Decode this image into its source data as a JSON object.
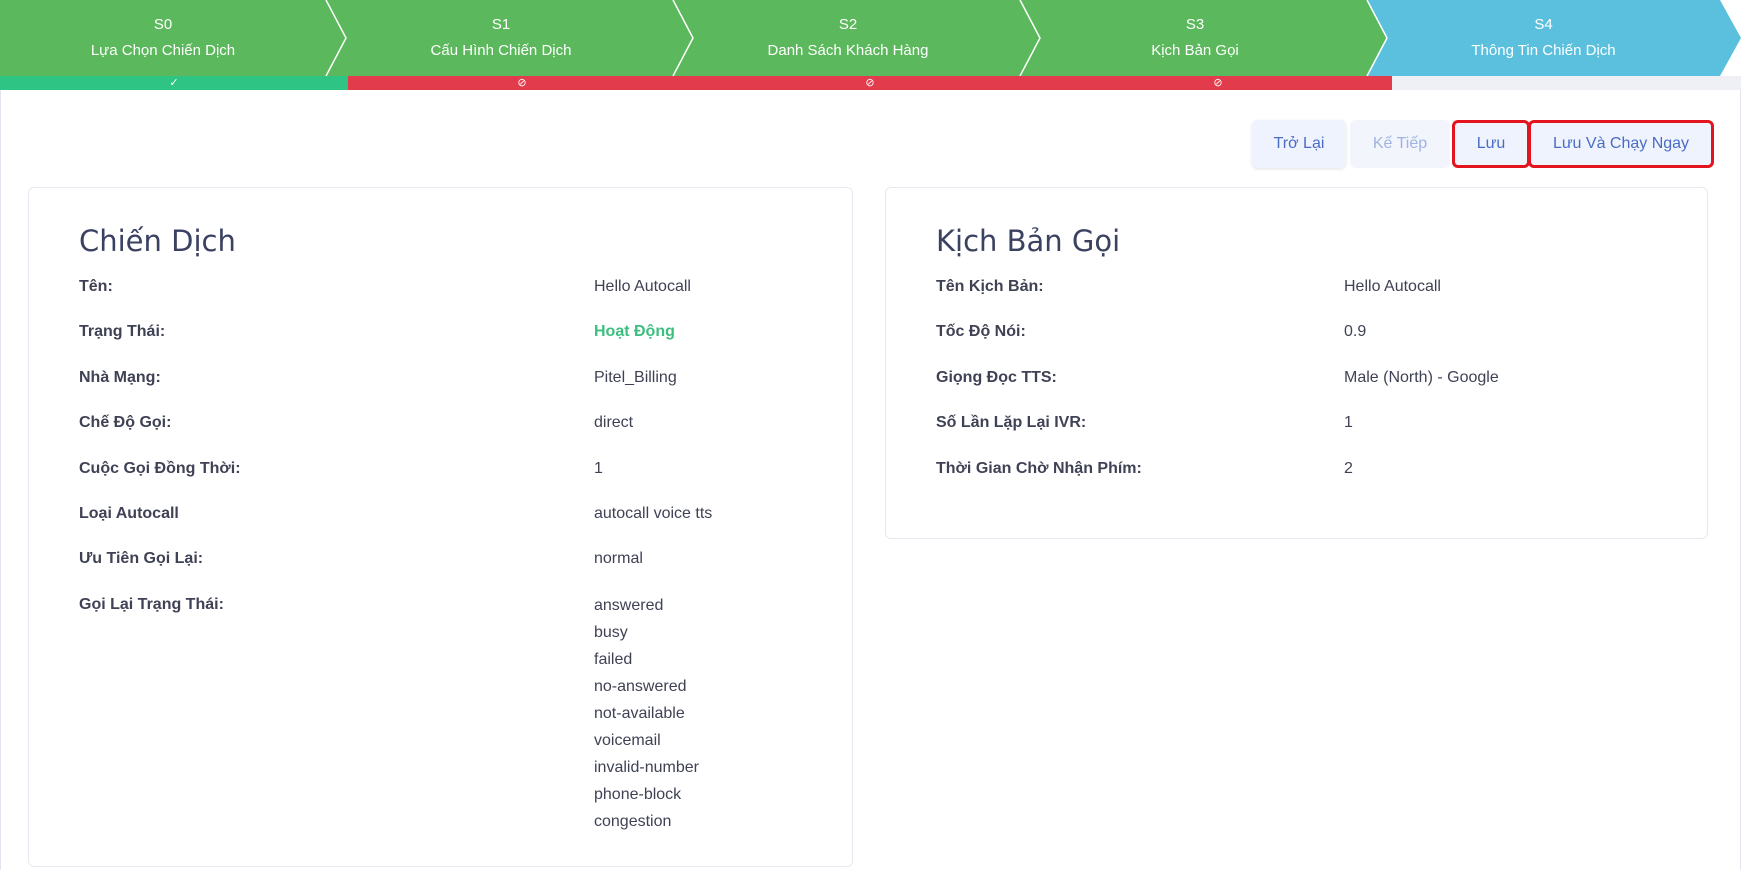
{
  "steps": [
    {
      "code": "S0",
      "name": "Lựa Chọn Chiến Dịch"
    },
    {
      "code": "S1",
      "name": "Cấu Hình Chiến Dịch"
    },
    {
      "code": "S2",
      "name": "Danh Sách Khách Hàng"
    },
    {
      "code": "S3",
      "name": "Kịch Bản Gọi"
    },
    {
      "code": "S4",
      "name": "Thông Tin Chiến Dịch"
    }
  ],
  "colors": {
    "step_done": "#5cb85c",
    "step_active": "#5bc0de",
    "progress_ok": "#2ec483",
    "progress_blocked": "#e23c4c",
    "progress_empty": "#eef0f6",
    "status_active": "#3cbf7e",
    "highlight_border": "#e3141d"
  },
  "progress_icons": [
    "check-icon",
    "blocked-icon",
    "blocked-icon",
    "blocked-icon"
  ],
  "toolbar": {
    "back": "Trở Lại",
    "next": "Kế Tiếp",
    "save": "Lưu",
    "save_run": "Lưu Và Chạy Ngay"
  },
  "campaign": {
    "title": "Chiến Dịch",
    "fields": [
      {
        "label": "Tên:",
        "value": "Hello Autocall"
      },
      {
        "label": "Trạng Thái:",
        "value": "Hoạt Động"
      },
      {
        "label": "Nhà Mạng:",
        "value": "Pitel_Billing"
      },
      {
        "label": "Chế Độ Gọi:",
        "value": "direct"
      },
      {
        "label": "Cuộc Gọi Đồng Thời:",
        "value": "1"
      },
      {
        "label": "Loại Autocall",
        "value": "autocall voice tts"
      },
      {
        "label": "Ưu Tiên Gọi Lại:",
        "value": "normal"
      }
    ],
    "recall_label": "Gọi Lại Trạng Thái:",
    "recall_statuses": [
      "answered",
      "busy",
      "failed",
      "no-answered",
      "not-available",
      "voicemail",
      "invalid-number",
      "phone-block",
      "congestion"
    ]
  },
  "script": {
    "title": "Kịch Bản Gọi",
    "fields": [
      {
        "label": "Tên Kịch Bản:",
        "value": "Hello Autocall"
      },
      {
        "label": "Tốc Độ Nói:",
        "value": "0.9"
      },
      {
        "label": "Giọng Đọc TTS:",
        "value": "Male (North) - Google"
      },
      {
        "label": "Số Lần Lặp Lại IVR:",
        "value": "1"
      },
      {
        "label": "Thời Gian Chờ Nhận Phím:",
        "value": "2"
      }
    ]
  }
}
